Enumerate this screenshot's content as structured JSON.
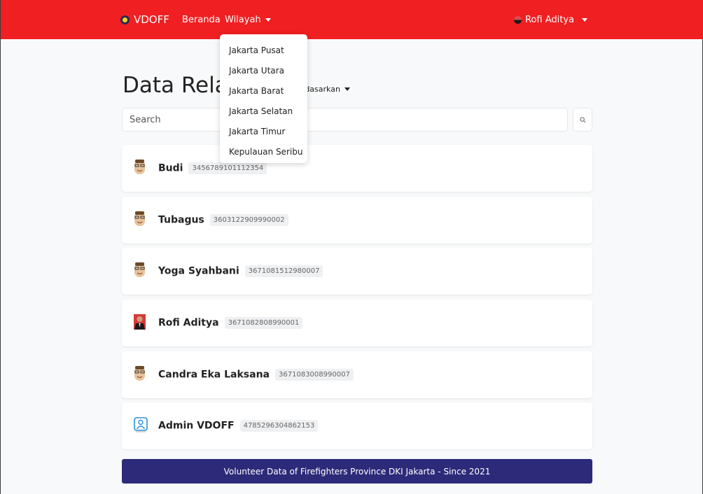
{
  "navbar": {
    "brand": "VDOFF",
    "links": {
      "home": "Beranda",
      "region": "Wilayah"
    },
    "user": "Rofi Aditya",
    "bg_color": "#f01f22"
  },
  "dropdown": {
    "items": [
      "Jakarta Pusat",
      "Jakarta Utara",
      "Jakarta Barat",
      "Jakarta Selatan",
      "Jakarta Timur",
      "Kepulauan Seribu"
    ]
  },
  "page": {
    "title": "Data Relav",
    "sort_label": "rdasarkan"
  },
  "search": {
    "placeholder": "Search",
    "icon": "search-icon"
  },
  "volunteers": [
    {
      "name": "Budi",
      "nik": "3456789101112354",
      "avatar": "cartoon-face"
    },
    {
      "name": "Tubagus",
      "nik": "3603122909990002",
      "avatar": "cartoon-face"
    },
    {
      "name": "Yoga Syahbani",
      "nik": "3671081512980007",
      "avatar": "cartoon-face"
    },
    {
      "name": "Rofi Aditya",
      "nik": "3671082808990001",
      "avatar": "photo"
    },
    {
      "name": "Candra Eka Laksana",
      "nik": "3671083008990007",
      "avatar": "cartoon-face"
    },
    {
      "name": "Admin VDOFF",
      "nik": "4785296304862153",
      "avatar": "user-outline"
    }
  ],
  "footer": {
    "text": "Volunteer Data of Firefighters Province DKI Jakarta - Since 2021",
    "bg_color": "#2d2a7a"
  }
}
